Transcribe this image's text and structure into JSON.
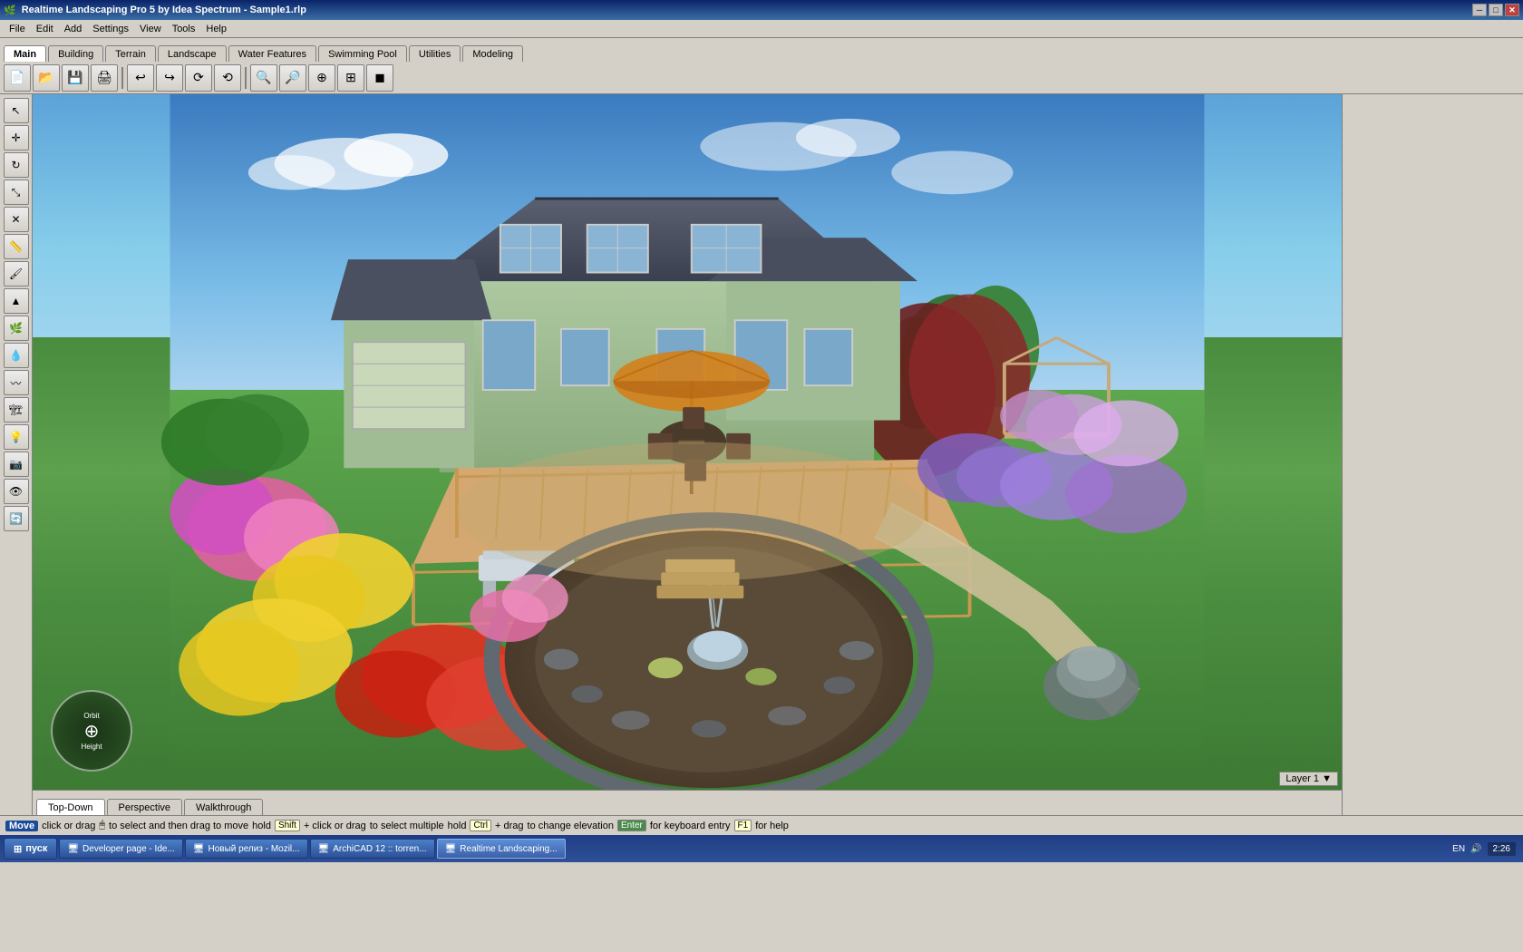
{
  "titlebar": {
    "title": "Realtime Landscaping Pro 5 by Idea Spectrum - Sample1.rlp",
    "controls": [
      "minimize",
      "restore",
      "close"
    ]
  },
  "menubar": {
    "items": [
      "File",
      "Edit",
      "Add",
      "Settings",
      "View",
      "Tools",
      "Help"
    ]
  },
  "tabs": {
    "items": [
      "Main",
      "Building",
      "Terrain",
      "Landscape",
      "Water Features",
      "Swimming Pool",
      "Utilities",
      "Modeling"
    ],
    "active": "Main"
  },
  "toolbar": {
    "buttons": [
      {
        "name": "new",
        "icon": "📄"
      },
      {
        "name": "open",
        "icon": "📂"
      },
      {
        "name": "save",
        "icon": "💾"
      },
      {
        "name": "print",
        "icon": "🖨"
      },
      {
        "name": "undo",
        "icon": "↩"
      },
      {
        "name": "redo",
        "icon": "↪"
      },
      {
        "name": "rotate-left",
        "icon": "◁"
      },
      {
        "name": "rotate-right",
        "icon": "▷"
      },
      {
        "name": "zoom-in",
        "icon": "🔍"
      },
      {
        "name": "zoom-out",
        "icon": "🔎"
      },
      {
        "name": "pan",
        "icon": "✋"
      },
      {
        "name": "fit",
        "icon": "⊞"
      }
    ]
  },
  "left_toolbar": {
    "buttons": [
      {
        "name": "select",
        "icon": "↖"
      },
      {
        "name": "move",
        "icon": "✛"
      },
      {
        "name": "rotate",
        "icon": "↻"
      },
      {
        "name": "scale",
        "icon": "⤡"
      },
      {
        "name": "delete",
        "icon": "✕"
      },
      {
        "name": "measure",
        "icon": "📏"
      },
      {
        "name": "paint",
        "icon": "🖌"
      },
      {
        "name": "terrain-edit",
        "icon": "⛰"
      },
      {
        "name": "plant",
        "icon": "🌿"
      },
      {
        "name": "water",
        "icon": "💧"
      },
      {
        "name": "path",
        "icon": "〰"
      },
      {
        "name": "structure",
        "icon": "🏗"
      },
      {
        "name": "light",
        "icon": "💡"
      },
      {
        "name": "camera",
        "icon": "📷"
      },
      {
        "name": "eye",
        "icon": "👁"
      },
      {
        "name": "refresh",
        "icon": "🔄"
      }
    ]
  },
  "view_tabs": {
    "items": [
      "Top-Down",
      "Perspective",
      "Walkthrough"
    ],
    "active": "Top-Down"
  },
  "layer": {
    "label": "Layer 1",
    "arrow": "▼"
  },
  "statusbar": {
    "action": "Move",
    "instruction": "click or drag",
    "cursor_icon": "🖱",
    "text1": "to select and then drag to move",
    "modifier1": "hold",
    "key1": "Shift",
    "text2": "+ click or drag",
    "text3": "to select multiple",
    "modifier2": "hold",
    "key2": "Ctrl",
    "text4": "+ drag",
    "text5": "to change elevation",
    "key3": "Enter",
    "text6": "for keyboard entry",
    "key4": "F1",
    "text7": "for help"
  },
  "taskbar": {
    "start_label": "пуск",
    "items": [
      {
        "label": "Developer page - Ide...",
        "active": false
      },
      {
        "label": "Новый релиз - Mozil...",
        "active": false
      },
      {
        "label": "ArchiCAD 12 :: torren...",
        "active": false
      },
      {
        "label": "Realtime Landscaping...",
        "active": true
      }
    ],
    "system_icons": [
      "EN",
      "🔊",
      "🕐"
    ],
    "clock": "2:26"
  },
  "compass": {
    "orbit_label": "Orbit",
    "height_label": "Height"
  }
}
